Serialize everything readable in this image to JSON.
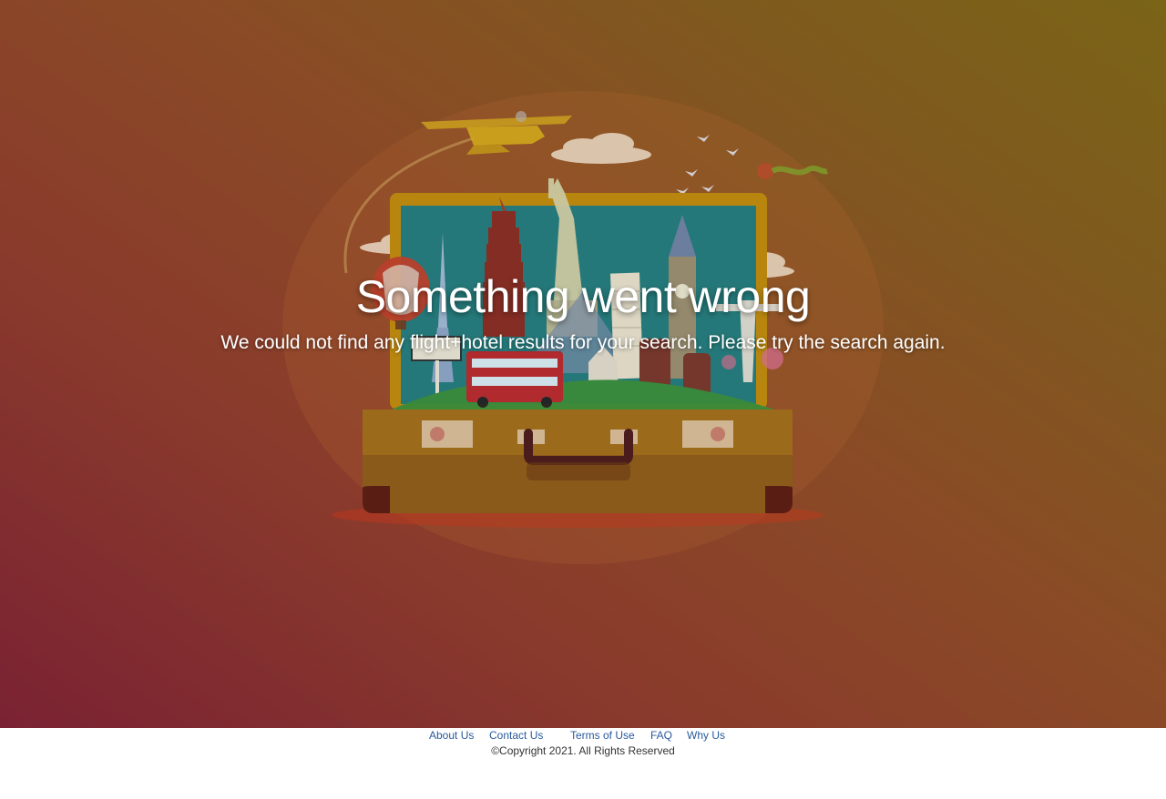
{
  "error": {
    "title": "Something went wrong",
    "message": "We could not find any flight+hotel results for your search. Please try the search again."
  },
  "illustration": {
    "icon": "travel-suitcase-landmarks-illustration"
  },
  "footer": {
    "links": [
      {
        "label": "About Us"
      },
      {
        "label": "Contact Us"
      },
      {
        "label": "Terms of Use"
      },
      {
        "label": "FAQ"
      },
      {
        "label": "Why Us"
      }
    ],
    "copyright": "©Copyright 2021. All Rights Reserved"
  },
  "colors": {
    "hero_gradient_start": "#7a2233",
    "hero_gradient_end": "#7a6417",
    "link": "#2a5a9c",
    "text_light": "#ffffff"
  }
}
